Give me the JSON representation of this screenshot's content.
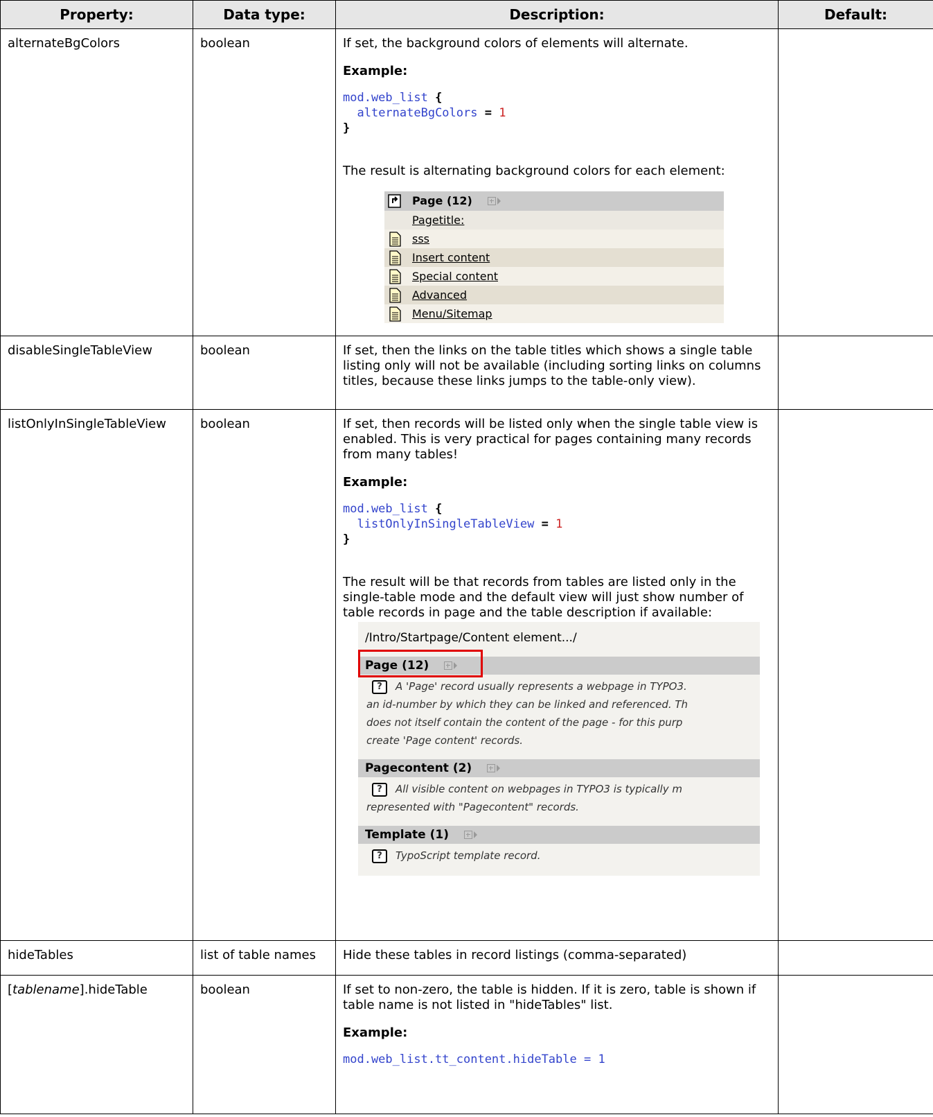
{
  "headers": {
    "property": "Property:",
    "datatype": "Data type:",
    "description": "Description:",
    "default": "Default:"
  },
  "rows": {
    "alternate": {
      "property": "alternateBgColors",
      "datatype": "boolean",
      "desc1": "If set, the background colors of elements will alternate.",
      "example_label": "Example:",
      "code_line1_kw": "mod.web_list",
      "code_line1_brace": "{",
      "code_line2_kw": "alternateBgColors",
      "code_line2_eq": "=",
      "code_line2_num": "1",
      "code_line3_brace": "}",
      "desc2": "The result is alternating background colors for each element:"
    },
    "disable": {
      "property": "disableSingleTableView",
      "datatype": "boolean",
      "desc": "If set, then the links on the table titles which shows a single table listing only will not be available (including sorting links on columns titles, because these links jumps to the table-only view)."
    },
    "listonly": {
      "property": "listOnlyInSingleTableView",
      "datatype": "boolean",
      "desc1": "If set, then records will be listed only when the single table view is enabled. This is very practical for pages containing many records from many tables!",
      "example_label": "Example:",
      "code_line1_kw": "mod.web_list",
      "code_line1_brace": "{",
      "code_line2_kw": "listOnlyInSingleTableView",
      "code_line2_eq": "=",
      "code_line2_num": "1",
      "code_line3_brace": "}",
      "desc2": "The result will be that records from tables are listed only in the single-table mode and the default view will just show number of table records in page and the table description if available:"
    },
    "hidetables": {
      "property": "hideTables",
      "datatype": "list of table names",
      "desc": "Hide these tables in record listings (comma-separated)"
    },
    "hidetable": {
      "property_prefix": "[",
      "property_italic": "tablename",
      "property_suffix": "].hideTable",
      "datatype": "boolean",
      "desc": "If set to non-zero, the table is hidden. If it is zero, table is shown if table name is not listed in \"hideTables\" list.",
      "example_label": "Example:",
      "code_kw": "mod.web_list.tt_content.hideTable",
      "code_eq": "=",
      "code_num": "1"
    }
  },
  "shot1": {
    "head_title": "Page (12)",
    "label_row": "Pagetitle:",
    "items": [
      "sss",
      "Insert content",
      "Special content",
      "Advanced",
      "Menu/Sitemap"
    ],
    "icons": {
      "head": "page-up-icon",
      "item": "document-icon"
    }
  },
  "shot2": {
    "breadcrumb": "/Intro/Startpage/Content element.../",
    "sections": [
      {
        "title": "Page (12)",
        "lines": [
          "A 'Page' record usually represents a webpage in TYPO3.",
          "an id-number by which they can be linked and referenced. Th",
          "does not itself contain the content of the page - for this purp",
          "create 'Page content' records."
        ]
      },
      {
        "title": "Pagecontent (2)",
        "lines": [
          "All visible content on webpages in TYPO3 is typically m",
          "represented with \"Pagecontent\" records."
        ]
      },
      {
        "title": "Template (1)",
        "lines": [
          "TypoScript template record."
        ]
      }
    ],
    "help_glyph": "?",
    "highlight_color": "#e00000"
  }
}
